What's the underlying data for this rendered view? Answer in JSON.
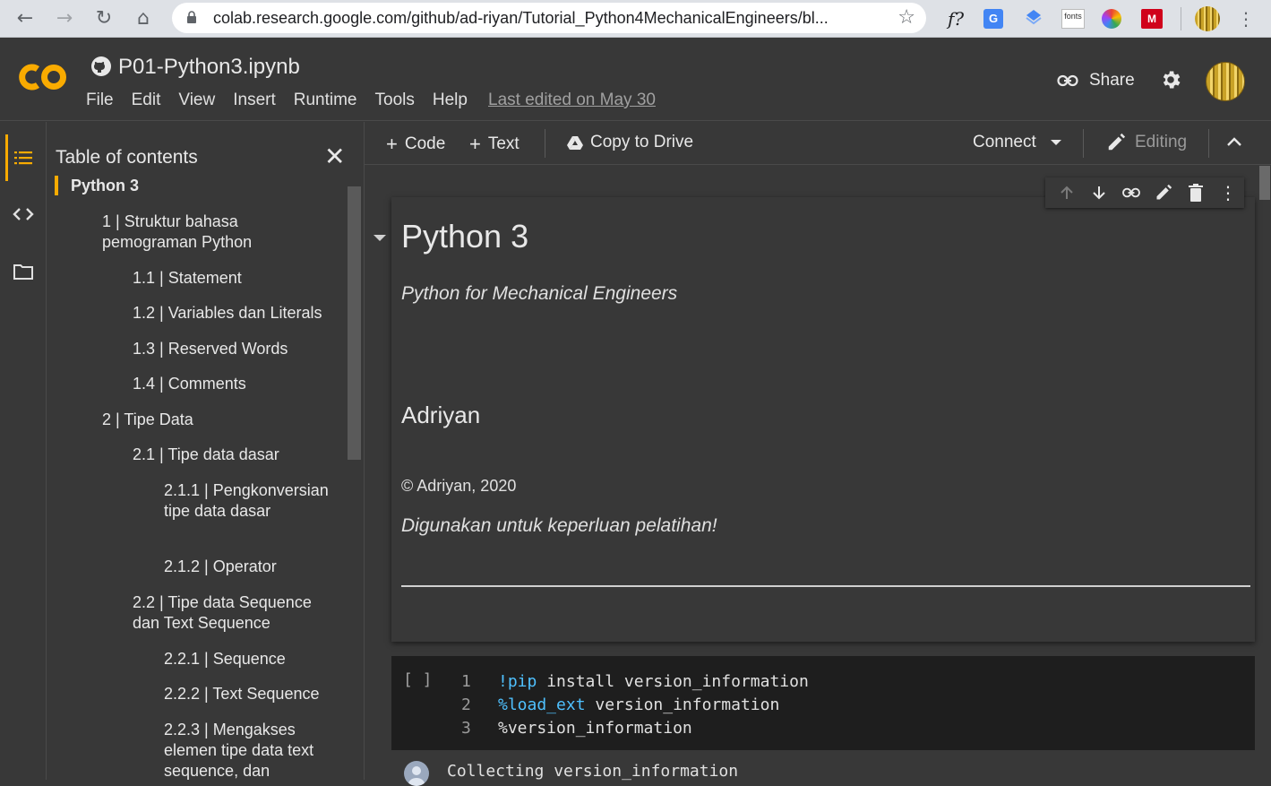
{
  "browser": {
    "url": "colab.research.google.com/github/ad-riyan/Tutorial_Python4MechanicalEngineers/bl...",
    "extensions": [
      "f?",
      "google-translate",
      "extension-diamond",
      "fonts",
      "color-wheel",
      "mendeley"
    ]
  },
  "header": {
    "logo_text": "CO",
    "notebook_title": "P01-Python3.ipynb",
    "menu": [
      "File",
      "Edit",
      "View",
      "Insert",
      "Runtime",
      "Tools",
      "Help"
    ],
    "last_edited": "Last edited on May 30",
    "share_label": "Share"
  },
  "toc": {
    "title": "Table of contents",
    "items": [
      {
        "text": "Python 3",
        "level": 0,
        "selected": true
      },
      {
        "text": "1 | Struktur bahasa pemograman Python",
        "level": 1
      },
      {
        "text": "1.1 | Statement",
        "level": 2
      },
      {
        "text": "1.2 | Variables dan Literals",
        "level": 2
      },
      {
        "text": "1.3 | Reserved Words",
        "level": 2
      },
      {
        "text": "1.4 | Comments",
        "level": 2
      },
      {
        "text": "2 | Tipe Data",
        "level": 1
      },
      {
        "text": "2.1 | Tipe data dasar",
        "level": 2
      },
      {
        "text": "2.1.1 | Pengkonversian tipe data dasar",
        "level": 3
      },
      {
        "text": "2.1.2 | Operator",
        "level": 3
      },
      {
        "text": "2.2 | Tipe data Sequence dan Text Sequence",
        "level": 2
      },
      {
        "text": "2.2.1 | Sequence",
        "level": 3
      },
      {
        "text": "2.2.2 | Text Sequence",
        "level": 3
      },
      {
        "text": "2.2.3 | Mengakses elemen tipe data text sequence, dan",
        "level": 3
      }
    ]
  },
  "toolbar": {
    "code_label": "Code",
    "text_label": "Text",
    "copy_to_drive_label": "Copy to Drive",
    "connect_label": "Connect",
    "editing_label": "Editing"
  },
  "text_cell": {
    "heading": "Python 3",
    "subtitle": "Python for Mechanical Engineers",
    "author": "Adriyan",
    "copyright": "© Adriyan, 2020",
    "usage": "Digunakan untuk keperluan pelatihan!"
  },
  "code_cell": {
    "run_bracket": "[ ]",
    "lines": [
      {
        "num": "1",
        "magic": "!pip",
        "rest": " install version_information"
      },
      {
        "num": "2",
        "magic": "%load_ext",
        "rest": " version_information"
      },
      {
        "num": "3",
        "magic": "",
        "rest": "%version_information"
      }
    ],
    "output": "Collecting version_information"
  },
  "colors": {
    "accent": "#f9ab00",
    "background": "#383838",
    "code_background": "#1e1e1e",
    "magic_keyword": "#4fc1ff"
  }
}
